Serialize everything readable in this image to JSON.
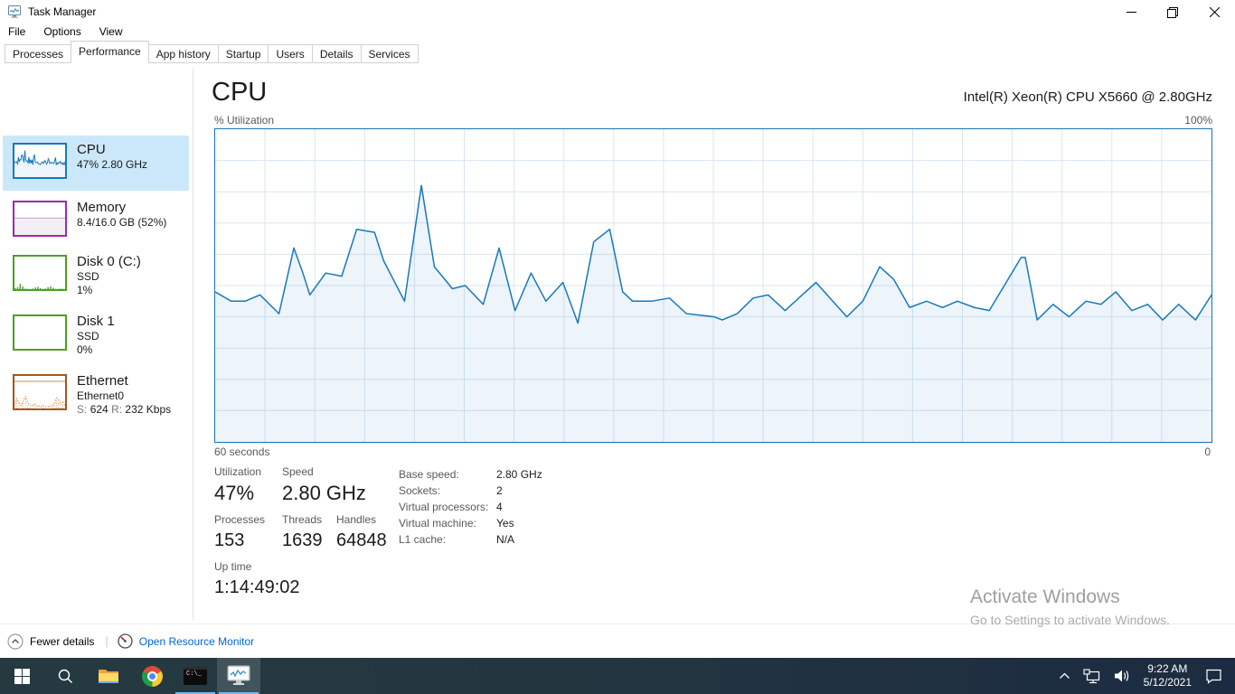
{
  "titlebar": {
    "title": "Task Manager"
  },
  "menubar": {
    "items": [
      "File",
      "Options",
      "View"
    ]
  },
  "tabs": {
    "items": [
      "Processes",
      "Performance",
      "App history",
      "Startup",
      "Users",
      "Details",
      "Services"
    ],
    "selected": "Performance"
  },
  "sidebar": {
    "items": [
      {
        "id": "cpu",
        "title": "CPU",
        "line2": "47% 2.80 GHz",
        "selected": true,
        "accent_color": "#1779ba"
      },
      {
        "id": "memory",
        "title": "Memory",
        "line2": "8.4/16.0 GB (52%)",
        "accent_color": "#9a2ab4",
        "thumb_fill_pct": 52
      },
      {
        "id": "disk0",
        "title": "Disk 0 (C:)",
        "line2": "SSD",
        "line3": "1%",
        "accent_color": "#4ba024",
        "thumb_spikes": [
          3,
          6,
          16,
          8,
          2,
          1,
          0,
          2,
          5,
          7,
          3,
          1,
          2,
          6,
          8,
          4,
          1,
          1,
          2,
          1
        ]
      },
      {
        "id": "disk1",
        "title": "Disk 1",
        "line2": "SSD",
        "line3": "0%",
        "accent_color": "#4ba024",
        "thumb_spikes": []
      },
      {
        "id": "ethernet",
        "title": "Ethernet",
        "line2": "Ethernet0",
        "line3": {
          "s_label": "S:",
          "s_value": "624",
          "r_label": "R:",
          "r_value": "232 Kbps"
        },
        "accent_color": "#a0591d",
        "thumb_spikes": [
          12,
          30,
          20,
          8,
          24,
          37,
          17,
          10,
          7,
          14,
          6,
          8,
          4,
          10,
          6,
          4,
          8,
          7,
          15,
          32,
          26,
          12,
          19,
          8
        ]
      }
    ]
  },
  "main": {
    "page_title": "CPU",
    "processor_name": "Intel(R) Xeon(R) CPU X5660 @ 2.80GHz",
    "y_axis_label": "% Utilization",
    "y_axis_max": "100%",
    "x_axis_left": "60 seconds",
    "x_axis_right": "0",
    "big_stats": [
      {
        "label": "Utilization",
        "value": "47%"
      },
      {
        "label": "Speed",
        "value": "2.80 GHz"
      },
      {
        "label": "Processes",
        "value": "153"
      },
      {
        "label": "Threads",
        "value": "1639"
      },
      {
        "label": "Handles",
        "value": "64848"
      },
      {
        "label": "Up time",
        "value": "1:14:49:02"
      }
    ],
    "details": [
      {
        "label": "Base speed:",
        "value": "2.80 GHz"
      },
      {
        "label": "Sockets:",
        "value": "2"
      },
      {
        "label": "Virtual processors:",
        "value": "4"
      },
      {
        "label": "Virtual machine:",
        "value": "Yes"
      },
      {
        "label": "L1 cache:",
        "value": "N/A"
      }
    ]
  },
  "chart_data": {
    "type": "area",
    "title": "CPU % Utilization over last 60 seconds",
    "x_left_label": "60 seconds",
    "x_right_label": "0",
    "ylim": [
      0,
      100
    ],
    "grid": {
      "v_divisions": 20,
      "h_divisions": 10
    },
    "line_color": "#1779ba",
    "grid_color": "#d8e6f2",
    "fill_color": "rgba(23,121,186,0.08)",
    "current_utilization_pct": 47,
    "series": [
      {
        "name": "CPU utilization % (x = percent across window, left oldest)",
        "points": [
          [
            0,
            48
          ],
          [
            1.6,
            45
          ],
          [
            3.0,
            45
          ],
          [
            4.5,
            47
          ],
          [
            6.4,
            41
          ],
          [
            7.9,
            62
          ],
          [
            8.8,
            54
          ],
          [
            9.5,
            47
          ],
          [
            11.1,
            54
          ],
          [
            12.7,
            53
          ],
          [
            14.2,
            68
          ],
          [
            16.0,
            67
          ],
          [
            16.9,
            58
          ],
          [
            19.0,
            45
          ],
          [
            20.7,
            82
          ],
          [
            22.0,
            56
          ],
          [
            23.3,
            51
          ],
          [
            23.8,
            49
          ],
          [
            25.1,
            50
          ],
          [
            26.9,
            44
          ],
          [
            28.5,
            62
          ],
          [
            30.1,
            42
          ],
          [
            31.7,
            54
          ],
          [
            33.2,
            45
          ],
          [
            34.9,
            51
          ],
          [
            36.4,
            38
          ],
          [
            38.0,
            64
          ],
          [
            39.6,
            68
          ],
          [
            40.9,
            48
          ],
          [
            41.9,
            45
          ],
          [
            43.8,
            45
          ],
          [
            45.6,
            46
          ],
          [
            47.3,
            41
          ],
          [
            50.1,
            40
          ],
          [
            50.9,
            39
          ],
          [
            52.4,
            41
          ],
          [
            54.0,
            46
          ],
          [
            55.5,
            47
          ],
          [
            57.2,
            42
          ],
          [
            60.3,
            51
          ],
          [
            63.4,
            40
          ],
          [
            65.0,
            45
          ],
          [
            66.7,
            56
          ],
          [
            68.1,
            52
          ],
          [
            69.7,
            43
          ],
          [
            71.4,
            45
          ],
          [
            73.0,
            43
          ],
          [
            74.5,
            45
          ],
          [
            76.2,
            43
          ],
          [
            77.7,
            42
          ],
          [
            80.9,
            59
          ],
          [
            81.3,
            59
          ],
          [
            82.5,
            39
          ],
          [
            84.1,
            44
          ],
          [
            85.7,
            40
          ],
          [
            87.4,
            45
          ],
          [
            88.9,
            44
          ],
          [
            90.4,
            48
          ],
          [
            92.0,
            42
          ],
          [
            93.6,
            44
          ],
          [
            95.1,
            39
          ],
          [
            96.7,
            44
          ],
          [
            98.4,
            39
          ],
          [
            100,
            47
          ]
        ]
      }
    ]
  },
  "footer": {
    "fewer_details": "Fewer details",
    "open_resource_monitor": "Open Resource Monitor"
  },
  "watermark": {
    "title": "Activate Windows",
    "subtitle": "Go to Settings to activate Windows."
  },
  "taskbar": {
    "time": "9:22 AM",
    "date": "5/12/2021"
  }
}
